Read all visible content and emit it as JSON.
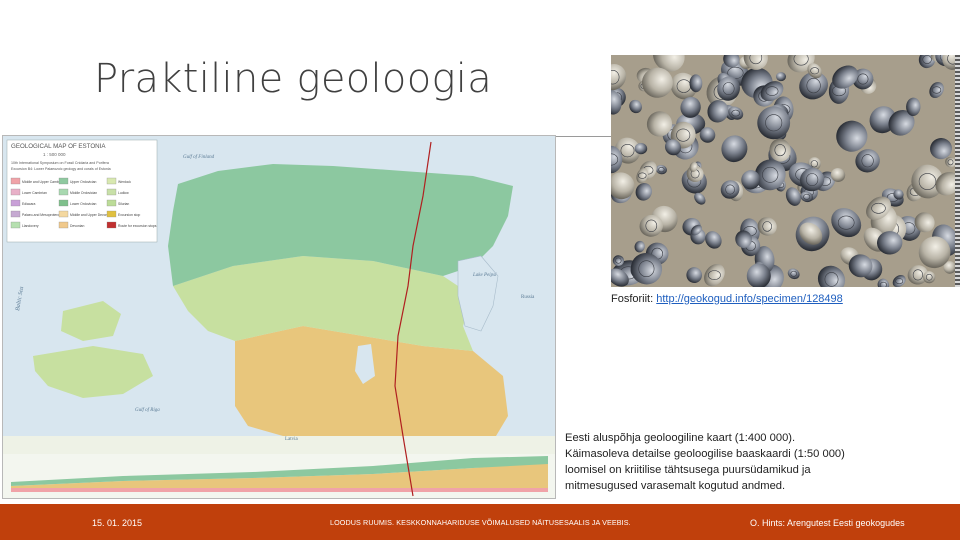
{
  "slide": {
    "title": "Praktiline geoloogia"
  },
  "map": {
    "title": "GEOLOGICAL MAP OF ESTONIA",
    "scale": "1 : 500 000",
    "subtitle_line1": "10th International Symposium on Fossil Cnidaria and Porifera",
    "subtitle_line2": "Excursion B4: Lower Palaeozoic geology and corals of Estonia",
    "legend": [
      {
        "label": "Middle and Upper Cambrian",
        "color": "#f0a3a8"
      },
      {
        "label": "Lower Cambrian",
        "color": "#e8b0c8"
      },
      {
        "label": "Ediacara",
        "color": "#c9a0d8"
      },
      {
        "label": "Palaeo-and Mesoproterozoic",
        "color": "#c6aad2"
      },
      {
        "label": "Llandovery",
        "color": "#b6e0b0"
      },
      {
        "label": "Upper Ordovician",
        "color": "#8fc9a0"
      },
      {
        "label": "Middle Ordovician",
        "color": "#a8d8b0"
      },
      {
        "label": "Lower Ordovician",
        "color": "#7fc08c"
      },
      {
        "label": "Middle and Upper Devonian",
        "color": "#f4d8a0"
      },
      {
        "label": "Devonian",
        "color": "#f0c98c"
      },
      {
        "label": "Wenlock",
        "color": "#d8e8b0"
      },
      {
        "label": "Ludlow",
        "color": "#c8e0a8"
      },
      {
        "label": "Silurian",
        "color": "#bcdc98"
      },
      {
        "label": "Excursion stop",
        "color": "#e0c040"
      },
      {
        "label": "Route for excursion stops",
        "color": "#c03030"
      }
    ],
    "sea_labels": [
      "Gulf of Finland",
      "Baltic Sea",
      "Gulf of Riga",
      "Lake Peipsi",
      "Russia",
      "Latvia"
    ],
    "colors": {
      "sea": "#d8e6ef",
      "ordovician": "#8cc8a0",
      "silurian": "#c7e0a0",
      "devonian": "#e8c67c",
      "route": "#b02020"
    }
  },
  "photo": {
    "caption_label": "Fosforiit:",
    "caption_link": "http://geokogud.info/specimen/128498"
  },
  "map_caption": {
    "line1": "Eesti aluspõhja geoloogiline kaart (1:400 000).",
    "line2": "Käimasoleva detailse geoloogilise baaskaardi (1:50 000)",
    "line3": "loomisel on kriitilise tähtsusega puursüdamikud ja",
    "line4": "mitmesugused varasemalt kogutud andmed."
  },
  "footer": {
    "date": "15. 01. 2015",
    "middle": "LOODUS RUUMIS. KESKKONNAHARIDUSE VÕIMALUSED NÄITUSESAALIS JA VEEBIS.",
    "author": "O. Hints: Arengutest Eesti geokogudes",
    "color": "#c0400c"
  }
}
